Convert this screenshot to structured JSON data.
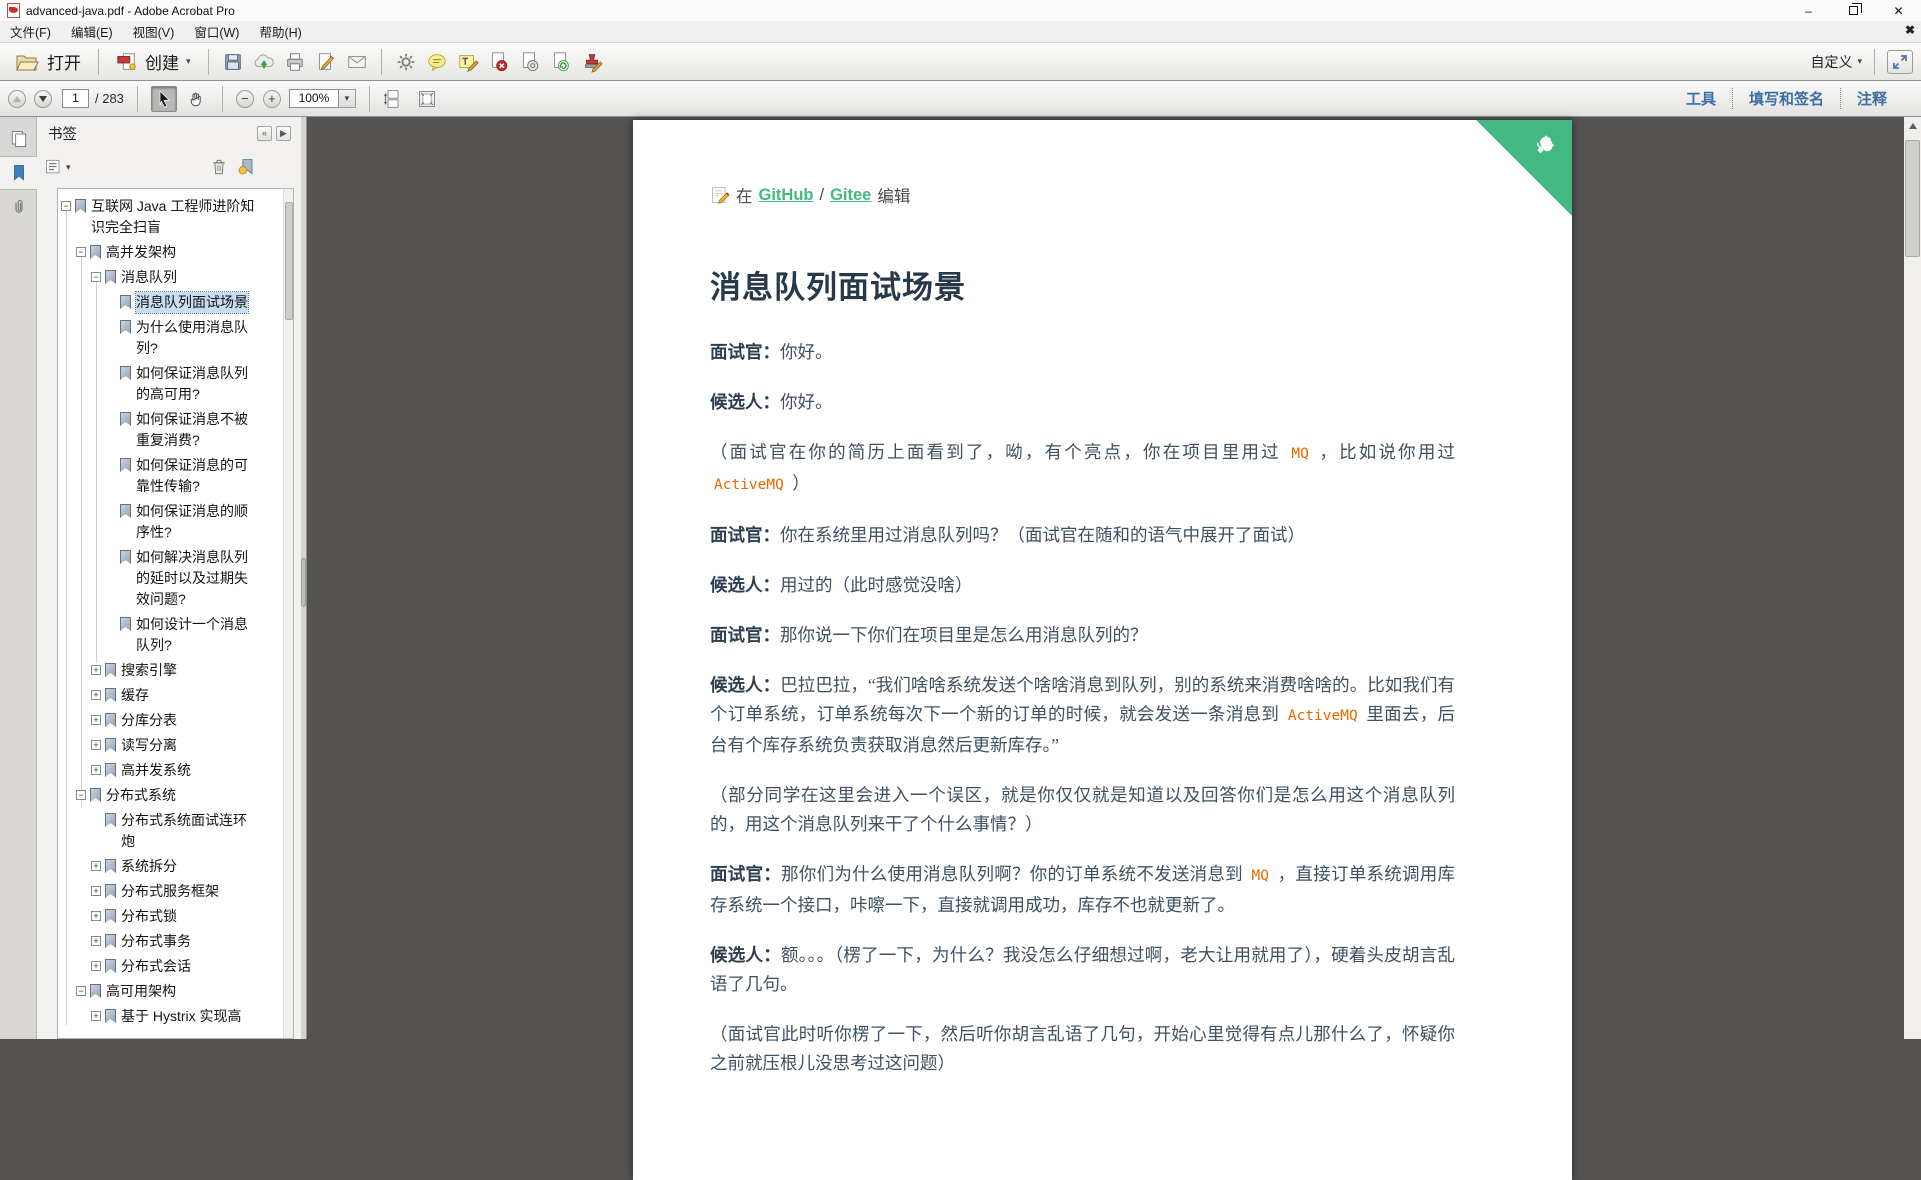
{
  "window": {
    "title": "advanced-java.pdf - Adobe Acrobat Pro"
  },
  "icons": {
    "minimize": "–",
    "close": "✕",
    "menu_close": "✖",
    "caret_down": "▼",
    "caret_small": "▾",
    "collapse_left": "«",
    "expand_right": "▶",
    "plus": "+",
    "minus": "−",
    "zoom_out": "−",
    "zoom_in": "+"
  },
  "menu_bar": {
    "items": [
      "文件(F)",
      "编辑(E)",
      "视图(V)",
      "窗口(W)",
      "帮助(H)"
    ]
  },
  "toolbar": {
    "open_label": "打开",
    "create_label": "创建",
    "customize_label": "自定义"
  },
  "nav_toolbar": {
    "page_number": "1",
    "page_count": "/ 283",
    "zoom_level": "100%",
    "right_tabs": [
      "工具",
      "填写和签名",
      "注释"
    ]
  },
  "sidebar": {
    "panel_title": "书签",
    "tree": [
      {
        "label": "互联网 Java 工程师进阶知\n识完全扫盲",
        "level": 0,
        "toggle": "minus"
      },
      {
        "label": "高并发架构",
        "level": 1,
        "toggle": "minus"
      },
      {
        "label": "消息队列",
        "level": 2,
        "toggle": "minus"
      },
      {
        "label": "消息队列面试场景",
        "level": 3,
        "toggle": "none",
        "selected": true
      },
      {
        "label": "为什么使用消息队\n列?",
        "level": 3,
        "toggle": "none"
      },
      {
        "label": "如何保证消息队列\n的高可用?",
        "level": 3,
        "toggle": "none"
      },
      {
        "label": "如何保证消息不被\n重复消费?",
        "level": 3,
        "toggle": "none"
      },
      {
        "label": "如何保证消息的可\n靠性传输?",
        "level": 3,
        "toggle": "none"
      },
      {
        "label": "如何保证消息的顺\n序性?",
        "level": 3,
        "toggle": "none"
      },
      {
        "label": "如何解决消息队列\n的延时以及过期失\n效问题?",
        "level": 3,
        "toggle": "none"
      },
      {
        "label": "如何设计一个消息\n队列?",
        "level": 3,
        "toggle": "none"
      },
      {
        "label": "搜索引擎",
        "level": 2,
        "toggle": "plus"
      },
      {
        "label": "缓存",
        "level": 2,
        "toggle": "plus"
      },
      {
        "label": "分库分表",
        "level": 2,
        "toggle": "plus"
      },
      {
        "label": "读写分离",
        "level": 2,
        "toggle": "plus"
      },
      {
        "label": "高并发系统",
        "level": 2,
        "toggle": "plus"
      },
      {
        "label": "分布式系统",
        "level": 1,
        "toggle": "minus"
      },
      {
        "label": "分布式系统面试连环\n炮",
        "level": 2,
        "toggle": "none"
      },
      {
        "label": "系统拆分",
        "level": 2,
        "toggle": "plus"
      },
      {
        "label": "分布式服务框架",
        "level": 2,
        "toggle": "plus"
      },
      {
        "label": "分布式锁",
        "level": 2,
        "toggle": "plus"
      },
      {
        "label": "分布式事务",
        "level": 2,
        "toggle": "plus"
      },
      {
        "label": "分布式会话",
        "level": 2,
        "toggle": "plus"
      },
      {
        "label": "高可用架构",
        "level": 1,
        "toggle": "minus"
      },
      {
        "label": "基于 Hystrix 实现高",
        "level": 2,
        "toggle": "plus"
      }
    ]
  },
  "document": {
    "edit_line": {
      "prefix": "在",
      "github": "GitHub",
      "separator": "/",
      "gitee": "Gitee",
      "suffix": "编辑"
    },
    "title": "消息队列面试场景",
    "paragraphs": [
      {
        "segments": [
          {
            "text": "面试官：",
            "style": "label"
          },
          {
            "text": "你好。",
            "style": "normal"
          }
        ]
      },
      {
        "segments": [
          {
            "text": "候选人：",
            "style": "label"
          },
          {
            "text": "你好。",
            "style": "normal"
          }
        ]
      },
      {
        "segments": [
          {
            "text": "（面试官在你的简历上面看到了，呦，有个亮点，你在项目里用过 ",
            "style": "normal"
          },
          {
            "text": "MQ",
            "style": "code"
          },
          {
            "text": " ，比如说你用过 ",
            "style": "normal"
          },
          {
            "text": "ActiveMQ",
            "style": "code"
          },
          {
            "text": " ）",
            "style": "normal"
          }
        ]
      },
      {
        "segments": [
          {
            "text": "面试官：",
            "style": "label"
          },
          {
            "text": "你在系统里用过消息队列吗？（面试官在随和的语气中展开了面试）",
            "style": "normal"
          }
        ]
      },
      {
        "segments": [
          {
            "text": "候选人：",
            "style": "label"
          },
          {
            "text": "用过的（此时感觉没啥）",
            "style": "normal"
          }
        ]
      },
      {
        "segments": [
          {
            "text": "面试官：",
            "style": "label"
          },
          {
            "text": "那你说一下你们在项目里是怎么用消息队列的？",
            "style": "normal"
          }
        ]
      },
      {
        "segments": [
          {
            "text": "候选人：",
            "style": "label"
          },
          {
            "text": "巴拉巴拉，“我们啥啥系统发送个啥啥消息到队列，别的系统来消费啥啥的。比如我们有个订单系统，订单系统每次下一个新的订单的时候，就会发送一条消息到 ",
            "style": "normal"
          },
          {
            "text": "ActiveMQ",
            "style": "code"
          },
          {
            "text": " 里面去，后台有个库存系统负责获取消息然后更新库存。”",
            "style": "normal"
          }
        ]
      },
      {
        "segments": [
          {
            "text": "（部分同学在这里会进入一个误区，就是你仅仅就是知道以及回答你们是怎么用这个消息队列的，用这个消息队列来干了个什么事情？）",
            "style": "normal"
          }
        ]
      },
      {
        "segments": [
          {
            "text": "面试官：",
            "style": "label"
          },
          {
            "text": "那你们为什么使用消息队列啊？你的订单系统不发送消息到 ",
            "style": "normal"
          },
          {
            "text": "MQ",
            "style": "code"
          },
          {
            "text": " ，直接订单系统调用库存系统一个接口，咔嚓一下，直接就调用成功，库存不也就更新了。",
            "style": "normal"
          }
        ]
      },
      {
        "segments": [
          {
            "text": "候选人：",
            "style": "label"
          },
          {
            "text": "额。。。（楞了一下，为什么？我没怎么仔细想过啊，老大让用就用了），硬着头皮胡言乱语了几句。",
            "style": "normal"
          }
        ]
      },
      {
        "segments": [
          {
            "text": "（面试官此时听你楞了一下，然后听你胡言乱语了几句，开始心里觉得有点儿那什么了，怀疑你之前就压根儿没思考过这问题）",
            "style": "normal"
          }
        ]
      }
    ]
  },
  "colors": {
    "accent_green": "#42b983",
    "code_orange": "#e96900",
    "tab_blue": "#3a6ea5",
    "canvas_gray": "#545351",
    "selection_blue": "#c9ddf0"
  }
}
